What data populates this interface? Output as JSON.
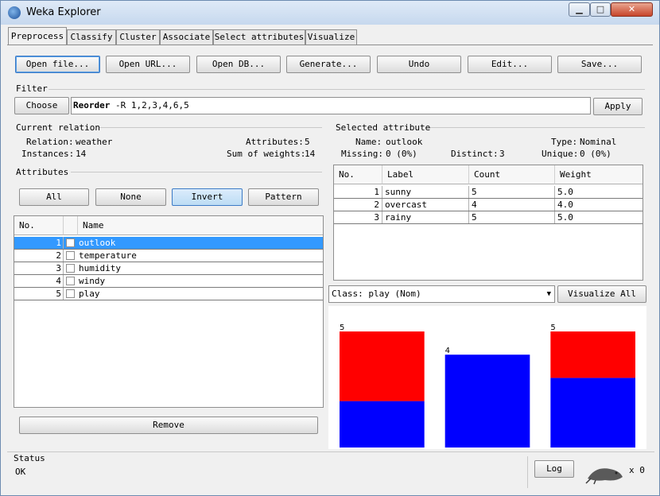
{
  "window": {
    "title": "Weka Explorer",
    "min_glyph": "▁",
    "max_glyph": "□",
    "close_glyph": "✕"
  },
  "tabs": [
    "Preprocess",
    "Classify",
    "Cluster",
    "Associate",
    "Select attributes",
    "Visualize"
  ],
  "toolbar": [
    "Open file...",
    "Open URL...",
    "Open DB...",
    "Generate...",
    "Undo",
    "Edit...",
    "Save..."
  ],
  "filter": {
    "section": "Filter",
    "choose": "Choose",
    "command_bold": "Reorder",
    "command_rest": " -R 1,2,3,4,6,5",
    "apply": "Apply"
  },
  "relation": {
    "section": "Current relation",
    "relation_label": "Relation:",
    "relation_value": "weather",
    "instances_label": "Instances:",
    "instances_value": "14",
    "attributes_label": "Attributes:",
    "attributes_value": "5",
    "sum_label": "Sum of weights:",
    "sum_value": "14"
  },
  "attributes": {
    "section": "Attributes",
    "buttons": [
      "All",
      "None",
      "Invert",
      "Pattern"
    ],
    "headers": [
      "No.",
      "Name"
    ],
    "rows": [
      {
        "no": "1",
        "name": "outlook"
      },
      {
        "no": "2",
        "name": "temperature"
      },
      {
        "no": "3",
        "name": "humidity"
      },
      {
        "no": "4",
        "name": "windy"
      },
      {
        "no": "5",
        "name": "play"
      }
    ],
    "remove": "Remove"
  },
  "selected": {
    "section": "Selected attribute",
    "name_label": "Name:",
    "name_value": "outlook",
    "type_label": "Type:",
    "type_value": "Nominal",
    "missing_label": "Missing:",
    "missing_value": "0 (0%)",
    "distinct_label": "Distinct:",
    "distinct_value": "3",
    "unique_label": "Unique:",
    "unique_value": "0 (0%)",
    "headers": [
      "No.",
      "Label",
      "Count",
      "Weight"
    ],
    "rows": [
      {
        "no": "1",
        "label": "sunny",
        "count": "5",
        "weight": "5.0"
      },
      {
        "no": "2",
        "label": "overcast",
        "count": "4",
        "weight": "4.0"
      },
      {
        "no": "3",
        "label": "rainy",
        "count": "5",
        "weight": "5.0"
      }
    ]
  },
  "class_select": {
    "value": "Class: play (Nom)",
    "visualize_all": "Visualize All"
  },
  "colors": {
    "red": "#ff0000",
    "blue": "#0000ff",
    "selection": "#3399ff"
  },
  "chart_data": {
    "type": "bar",
    "stacked": true,
    "categories": [
      "sunny",
      "overcast",
      "rainy"
    ],
    "series": [
      {
        "color": "#0000ff",
        "values": [
          2,
          4,
          3
        ]
      },
      {
        "color": "#ff0000",
        "values": [
          3,
          0,
          2
        ]
      }
    ],
    "totals": [
      "5",
      "4",
      "5"
    ],
    "ylim": [
      0,
      5
    ]
  },
  "status": {
    "section": "Status",
    "text": "OK",
    "log": "Log",
    "count": "x 0"
  }
}
